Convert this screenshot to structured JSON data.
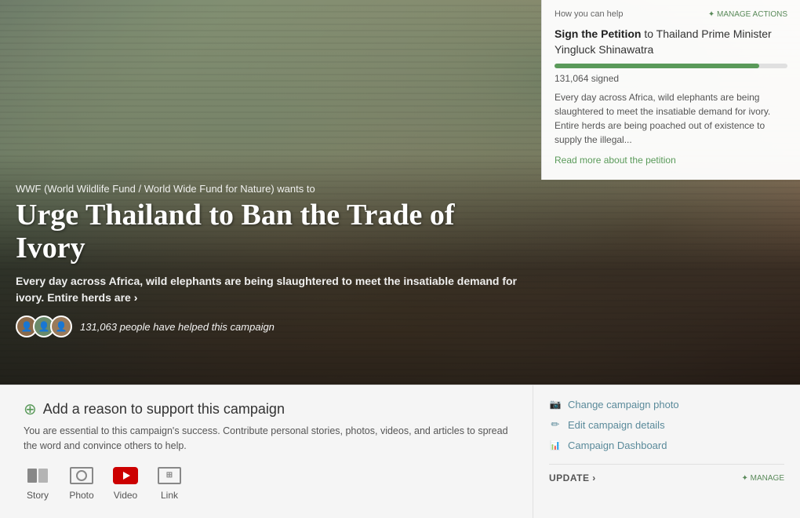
{
  "petition_panel": {
    "how_you_can_help": "How you can help",
    "manage_actions_label": "✦ MANAGE ACTIONS",
    "title_prefix": "Sign the Petition",
    "title_suffix": " to Thailand Prime Minister Yingluck Shinawatra",
    "signed_count": "131,064 signed",
    "description": "Every day across Africa, wild elephants are being slaughtered to meet the insatiable demand for ivory. Entire herds are being poached out of existence to supply the illegal...",
    "read_more": "Read more about the petition"
  },
  "hero": {
    "wwf_subtitle": "WWF (World Wildlife Fund / World Wide Fund for Nature) wants to",
    "campaign_title": "Urge Thailand to Ban the Trade of Ivory",
    "campaign_subtitle": "Every day across Africa, wild elephants are being slaughtered to meet the insatiable demand for ivory. Entire herds are",
    "campaign_subtitle_link": " ›",
    "supporters_count": "131,063 people have helped this campaign"
  },
  "bottom": {
    "add_reason_title": "Add a reason to support this campaign",
    "add_reason_desc": "You are essential to this campaign's success. Contribute personal stories, photos, videos, and articles to spread the word and convince others to help.",
    "content_types": [
      {
        "label": "Story",
        "icon": "story"
      },
      {
        "label": "Photo",
        "icon": "photo"
      },
      {
        "label": "Video",
        "icon": "video"
      },
      {
        "label": "Link",
        "icon": "link"
      }
    ],
    "action_links": [
      {
        "label": "Change campaign photo",
        "icon": "camera"
      },
      {
        "label": "Edit campaign details",
        "icon": "pencil"
      },
      {
        "label": "Campaign Dashboard",
        "icon": "chart"
      }
    ],
    "update_label": "UPDATE ›",
    "manage_label": "✦ MANAGE"
  }
}
